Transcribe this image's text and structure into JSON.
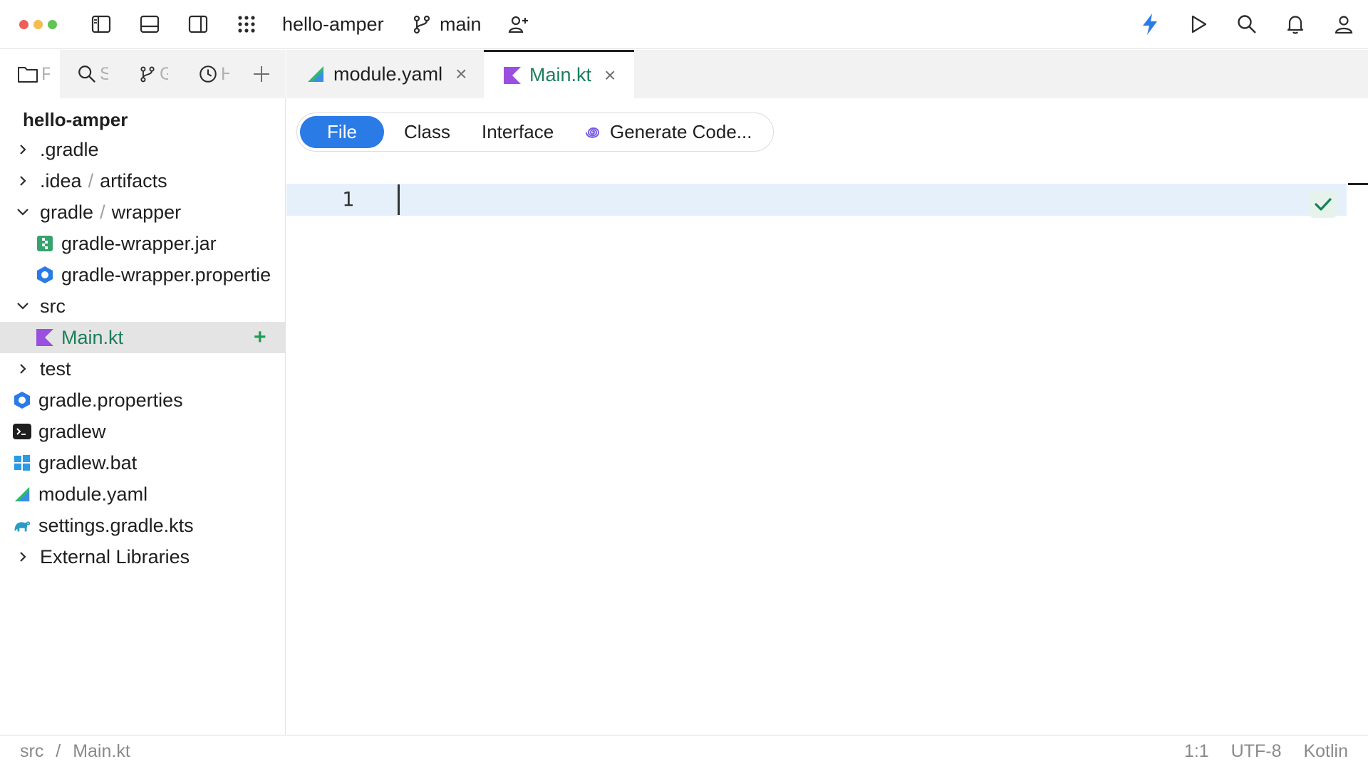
{
  "window": {
    "project_name": "hello-amper",
    "branch": "main"
  },
  "colors": {
    "close_dot": "#ee5f57",
    "minimize_dot": "#f5bd4f",
    "maximize_dot": "#61c454",
    "accent": "#2a7be6",
    "kotlin_purple": "#9b4fe0",
    "vcs_added_green": "#1f9d55"
  },
  "left_tool_tabs": [
    {
      "icon": "folder-icon",
      "label": "F"
    },
    {
      "icon": "search-icon",
      "label": "S"
    },
    {
      "icon": "git-branch-icon",
      "label": "G"
    },
    {
      "icon": "clock-icon",
      "label": "H"
    }
  ],
  "editor_tabs": [
    {
      "icon": "amper-icon",
      "label": "module.yaml",
      "active": false
    },
    {
      "icon": "kotlin-icon",
      "label": "Main.kt",
      "active": true
    }
  ],
  "project_tree": {
    "root": "hello-amper",
    "rows": [
      {
        "name": ".gradle",
        "chevron": "right",
        "icon": "",
        "depth": 0
      },
      {
        "name": ".idea",
        "suffix": "artifacts",
        "chevron": "right",
        "icon": "",
        "depth": 0
      },
      {
        "name": "gradle",
        "suffix": "wrapper",
        "chevron": "down",
        "icon": "",
        "depth": 0
      },
      {
        "name": "gradle-wrapper.jar",
        "chevron": "",
        "icon": "jar-icon",
        "depth": 1
      },
      {
        "name": "gradle-wrapper.propertie",
        "chevron": "",
        "icon": "properties-icon",
        "depth": 1
      },
      {
        "name": "src",
        "chevron": "down",
        "icon": "",
        "depth": 0
      },
      {
        "name": "Main.kt",
        "chevron": "",
        "icon": "kotlin-icon",
        "depth": 1,
        "selected": true,
        "added": true
      },
      {
        "name": "test",
        "chevron": "right",
        "icon": "",
        "depth": 0
      },
      {
        "name": "gradle.properties",
        "chevron": "",
        "icon": "properties-icon",
        "depth": 0
      },
      {
        "name": "gradlew",
        "chevron": "",
        "icon": "terminal-icon",
        "depth": 0
      },
      {
        "name": "gradlew.bat",
        "chevron": "",
        "icon": "windows-icon",
        "depth": 0
      },
      {
        "name": "module.yaml",
        "chevron": "",
        "icon": "amper-icon",
        "depth": 0
      },
      {
        "name": "settings.gradle.kts",
        "chevron": "",
        "icon": "gradle-elephant-icon",
        "depth": 0
      },
      {
        "name": "External Libraries",
        "chevron": "right",
        "icon": "",
        "depth": 0
      }
    ]
  },
  "new_file_options": {
    "file": "File",
    "class": "Class",
    "interface": "Interface",
    "generate": "Generate Code..."
  },
  "editor": {
    "line_number": "1"
  },
  "status_bar": {
    "breadcrumb_dir": "src",
    "breadcrumb_sep": "/",
    "breadcrumb_file": "Main.kt",
    "position": "1:1",
    "encoding": "UTF-8",
    "language": "Kotlin"
  }
}
